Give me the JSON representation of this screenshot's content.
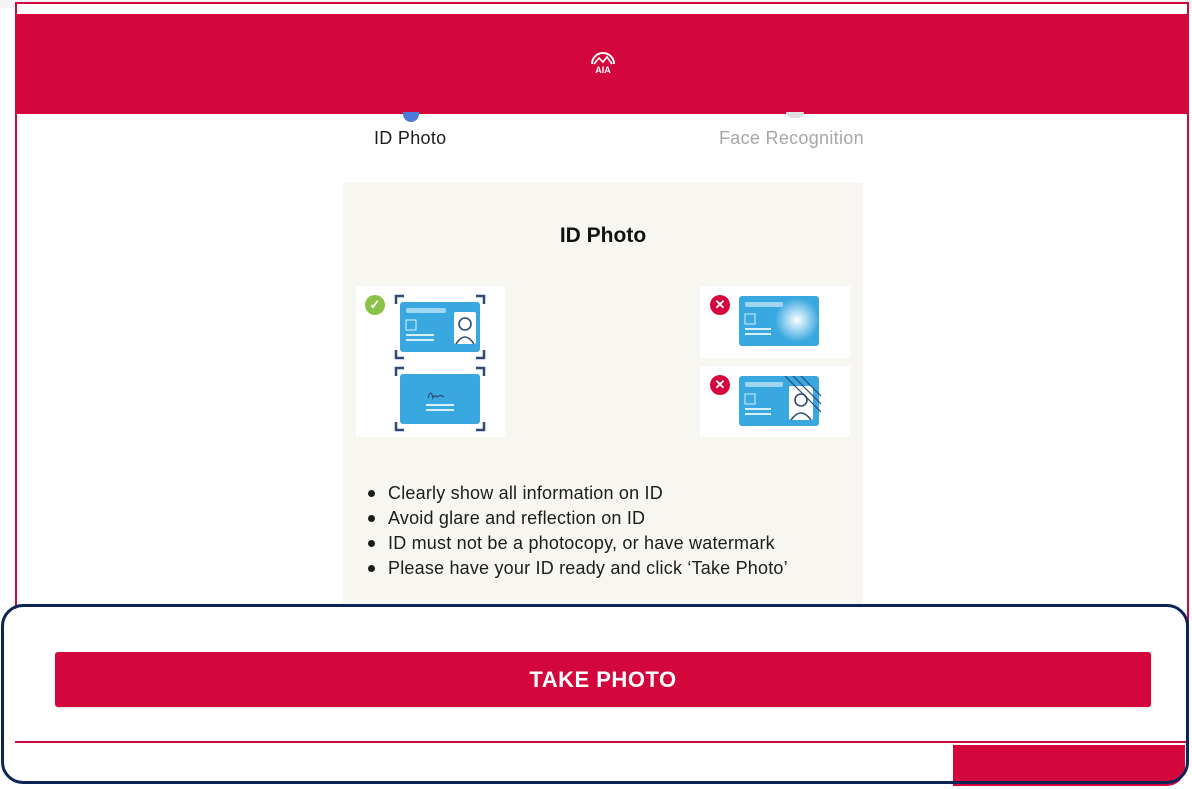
{
  "header": {
    "logo_icon": "aia-logo-icon",
    "brand_color": "#d4073d"
  },
  "steps": [
    {
      "label": "ID Photo",
      "state": "active",
      "color": "#1c1c1c",
      "dot_color": "#4a7bd9"
    },
    {
      "label": "Face Recognition",
      "state": "inactive",
      "color": "#a6a6a6",
      "dot_color": "#cccccc"
    }
  ],
  "card": {
    "title": "ID Photo",
    "examples": {
      "good": [
        "id-front-framed-icon",
        "id-back-signature-framed-icon"
      ],
      "bad": [
        "id-glare-icon",
        "id-watermark-icon"
      ]
    },
    "bullets": [
      "Clearly show all information on ID",
      "Avoid glare and reflection on ID",
      "ID must not be a photocopy, or have watermark",
      "Please have your ID ready and click ‘Take Photo’"
    ]
  },
  "actions": {
    "take_photo_label": "TAKE PHOTO"
  }
}
